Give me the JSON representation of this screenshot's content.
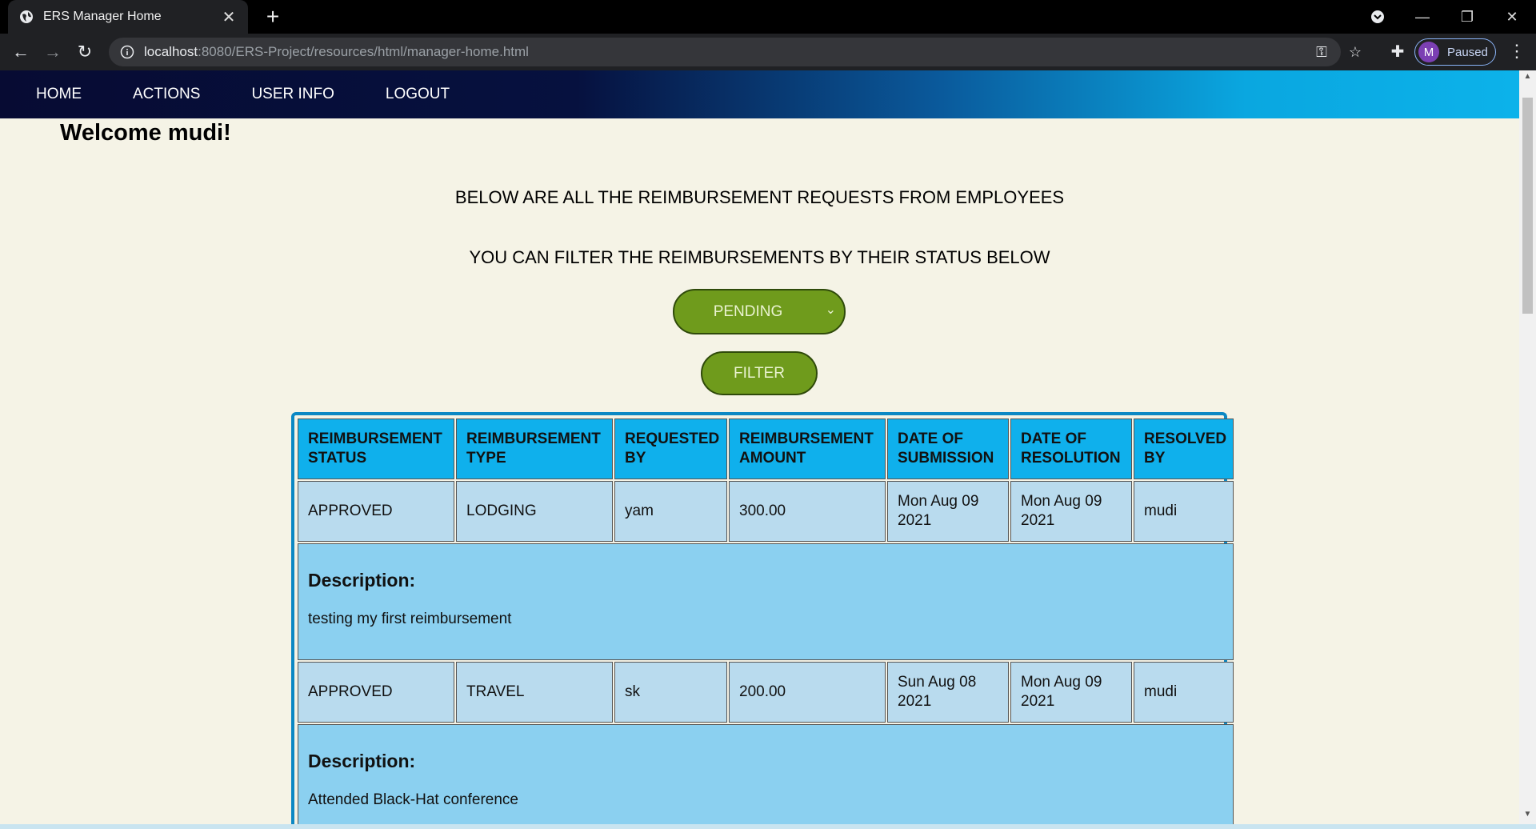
{
  "browser": {
    "tab_title": "ERS Manager Home",
    "url_host": "localhost",
    "url_path": ":8080/ERS-Project/resources/html/manager-home.html",
    "profile_initial": "M",
    "profile_status": "Paused",
    "icons": [
      "globe-icon",
      "close-icon",
      "plus-icon",
      "back-icon",
      "forward-icon",
      "reload-icon",
      "info-icon",
      "key-icon",
      "star-icon",
      "puzzle-icon",
      "kebab-menu-icon",
      "minimize-icon",
      "restore-icon"
    ]
  },
  "nav": {
    "home": "HOME",
    "actions": "ACTIONS",
    "user_info": "USER INFO",
    "logout": "LOGOUT"
  },
  "page": {
    "welcome": "Welcome mudi!",
    "heading1": "BELOW ARE ALL THE REIMBURSEMENT REQUESTS FROM EMPLOYEES",
    "heading2": "YOU CAN FILTER THE REIMBURSEMENTS BY THEIR STATUS BELOW",
    "status_selected": "PENDING",
    "filter_label": "FILTER"
  },
  "table": {
    "headers": [
      "REIMBURSEMENT STATUS",
      "REIMBURSEMENT TYPE",
      "REQUESTED BY",
      "REIMBURSEMENT AMOUNT",
      "DATE OF SUBMISSION",
      "DATE OF RESOLUTION",
      "RESOLVED BY"
    ],
    "description_label": "Description:",
    "rows": [
      {
        "cells": [
          "APPROVED",
          "LODGING",
          "yam",
          "300.00",
          "Mon Aug 09 2021",
          "Mon Aug 09 2021",
          "mudi"
        ],
        "description": "testing my first reimbursement"
      },
      {
        "cells": [
          "APPROVED",
          "TRAVEL",
          "sk",
          "200.00",
          "Sun Aug 08 2021",
          "Mon Aug 09 2021",
          "mudi"
        ],
        "description": "Attended Black-Hat conference"
      }
    ]
  },
  "colors": {
    "navbar_start": "#070b33",
    "navbar_end": "#0cb2ea",
    "button_green": "#6f9b1c",
    "header_blue": "#0fb0ec",
    "row_blue": "#b9dbee",
    "desc_blue": "#8bd0f0",
    "page_bg": "#f5f3e6"
  }
}
